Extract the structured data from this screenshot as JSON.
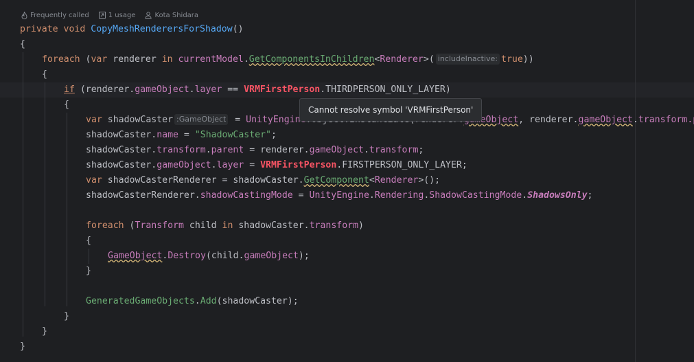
{
  "codevision": {
    "frequency": "Frequently called",
    "usages": "1 usage",
    "author": "Kota Shidara"
  },
  "tooltip": {
    "text": "Cannot resolve symbol 'VRMFirstPerson'"
  },
  "code": {
    "l1": {
      "kw1": "private",
      "kw2": "void",
      "method": "CopyMeshRenderersForShadow",
      "parens": "()"
    },
    "l2": {
      "brace": "{"
    },
    "l3": {
      "foreach": "foreach",
      "open": " (",
      "var": "var",
      "renderer": " renderer ",
      "in": "in",
      "sp": " ",
      "model": "currentModel",
      "dot": ".",
      "method": "GetComponentsInChildren",
      "lt": "<",
      "type": "Renderer",
      "gt": ">(",
      "hint": "includeInactive:",
      "value": "true",
      "close": "))"
    },
    "l4": {
      "brace": "{"
    },
    "l5": {
      "if": "if",
      "a": " (renderer.",
      "go": "gameObject",
      "dot1": ".",
      "layer": "layer",
      "eq": " == ",
      "err": "VRMFirstPerson",
      "rest": ".THIRDPERSON_ONLY_LAYER)"
    },
    "l6": {
      "brace": "{"
    },
    "l7": {
      "var": "var",
      "name": " shadowCaster",
      "hint": ":GameObject",
      "eq": " = ",
      "engine": "UnityEngine",
      "mid": ".Object.Instantiate(renderer.",
      "go": "gameObject",
      "comma": ", renderer.",
      "go2": "gameObject",
      "dot": ".",
      "transform": "transform",
      "tail": ".p"
    },
    "l8": {
      "a": "shadowCaster.",
      "name": "name",
      "eq": " = ",
      "str": "\"ShadowCaster\"",
      "end": ";"
    },
    "l9": {
      "a": "shadowCaster.",
      "transform": "transform",
      "dot": ".",
      "parent": "parent",
      "eq": " = renderer.",
      "go": "gameObject",
      "dot2": ".",
      "transform2": "transform",
      "end": ";"
    },
    "l10": {
      "a": "shadowCaster.",
      "go": "gameObject",
      "dot": ".",
      "layer": "layer",
      "eq": " = ",
      "err": "VRMFirstPerson",
      "rest": ".FIRSTPERSON_ONLY_LAYER;"
    },
    "l11": {
      "var": "var",
      "a": " shadowCasterRenderer = shadowCaster.",
      "method": "GetComponent",
      "lt": "<",
      "type": "Renderer",
      "end": ">();"
    },
    "l12": {
      "a": "shadowCasterRenderer.",
      "prop": "shadowCastingMode",
      "eq": " = ",
      "engine": "UnityEngine",
      "dot": ".",
      "rendering": "Rendering",
      "dot2": ".",
      "enum": "ShadowCastingMode",
      "dot3": ".",
      "val": "ShadowsOnly",
      "end": ";"
    },
    "l14": {
      "foreach": "foreach",
      "open": " (",
      "type": "Transform",
      "child": " child ",
      "in": "in",
      "a": " shadowCaster.",
      "transform": "transform",
      "close": ")"
    },
    "l15": {
      "brace": "{"
    },
    "l16": {
      "type": "GameObject",
      "dot": ".",
      "method": "Destroy",
      "a": "(child.",
      "go": "gameObject",
      "end": ");"
    },
    "l17": {
      "brace": "}"
    },
    "l19": {
      "list": "GeneratedGameObjects",
      "dot": ".",
      "method": "Add",
      "end": "(shadowCaster);"
    },
    "l20": {
      "brace": "}"
    },
    "l21": {
      "brace": "}"
    },
    "l22": {
      "brace": "}"
    }
  }
}
